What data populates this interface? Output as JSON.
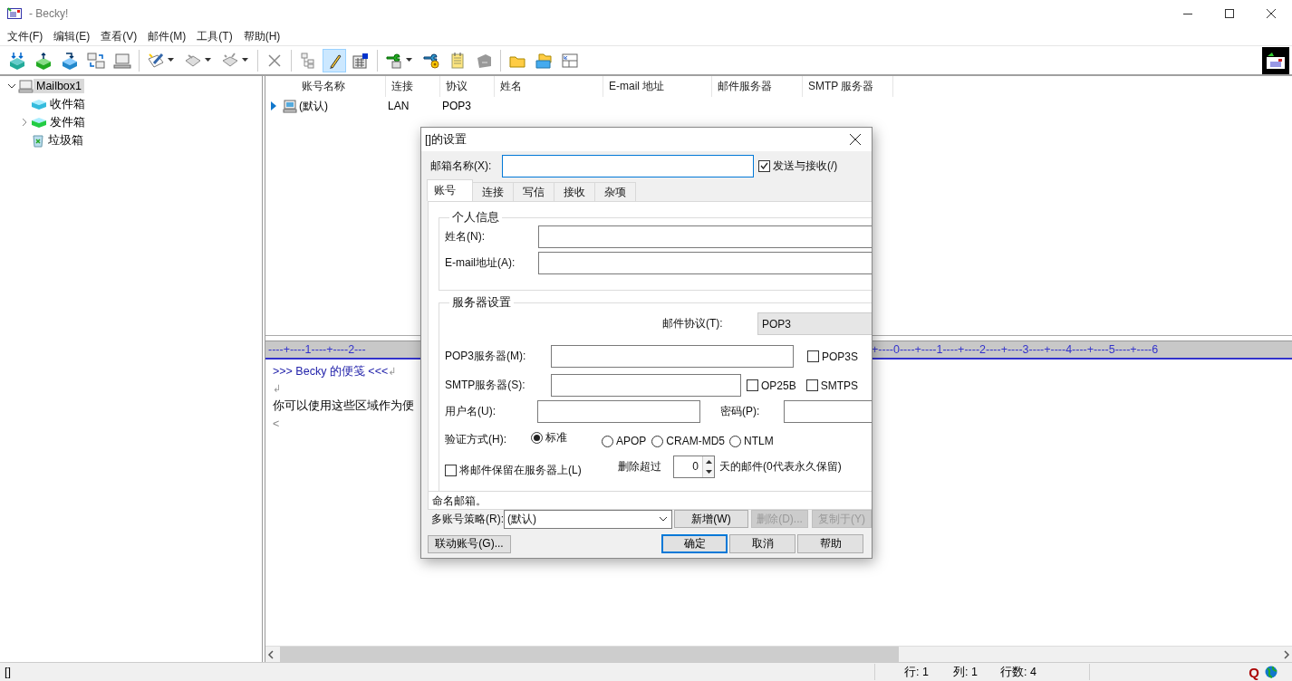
{
  "window": {
    "title": "- Becky!"
  },
  "menu": [
    "文件(F)",
    "编辑(E)",
    "查看(V)",
    "邮件(M)",
    "工具(T)",
    "帮助(H)"
  ],
  "toolbar": [
    [
      {
        "pressed": false
      },
      {
        "pressed": false
      },
      {
        "pressed": false
      },
      {
        "pressed": false
      },
      {
        "pressed": false
      }
    ],
    [
      {
        "pressed": false,
        "dropdown": true
      },
      {
        "pressed": false,
        "dropdown": true
      },
      {
        "pressed": false,
        "dropdown": true
      }
    ],
    [
      {
        "pressed": false
      }
    ],
    [
      {
        "pressed": false
      },
      {
        "pressed": true
      },
      {
        "pressed": false
      }
    ],
    [
      {
        "pressed": false,
        "dropdown": true
      },
      {
        "pressed": false
      },
      {
        "pressed": false
      },
      {
        "pressed": false
      }
    ],
    [
      {
        "pressed": false
      },
      {
        "pressed": false
      },
      {
        "pressed": false
      }
    ]
  ],
  "tree": [
    {
      "label": "Mailbox1",
      "selected": true,
      "expanded": true,
      "children": [
        {
          "label": "收件箱",
          "selected": false
        },
        {
          "label": "发件箱",
          "selected": false,
          "expanded": false
        },
        {
          "label": "垃圾箱",
          "selected": false
        }
      ]
    }
  ],
  "accounts": {
    "columns": [
      "账号名称",
      "连接",
      "协议",
      "姓名",
      "E-mail 地址",
      "邮件服务器",
      "SMTP 服务器"
    ],
    "rows": [
      {
        "current": true,
        "cells": [
          "(默认)",
          "LAN",
          "POP3"
        ]
      }
    ]
  },
  "memo": {
    "ruler_left": "----+----1----+----2---",
    "ruler_right": "+----0----+----1----+----2----+----3----+----4----+----5----+----6",
    "lines": [
      {
        "kind": "heading",
        "text": ">>> Becky 的便笺 <<<",
        "eol": "↲"
      },
      {
        "kind": "text",
        "eol": "↲"
      },
      {
        "kind": "text",
        "text": "你可以使用这些区域作为便"
      },
      {
        "kind": "mark",
        "text": "<"
      }
    ]
  },
  "status_bar": {
    "left": "[]",
    "line": "行: 1",
    "column": "列: 1",
    "count": "行数: 4",
    "q": "Q"
  },
  "dialog": {
    "title": "[]的设置",
    "mailbox_name": {
      "label": "邮箱名称(X):"
    },
    "send_receive": {
      "label": "发送与接收(/)",
      "checked": true
    },
    "tabs": [
      {
        "label": "账号",
        "selected": true
      },
      {
        "label": "连接",
        "selected": false
      },
      {
        "label": "写信",
        "selected": false
      },
      {
        "label": "接收",
        "selected": false
      },
      {
        "label": "杂项",
        "selected": false
      }
    ],
    "personal": {
      "title": "个人信息",
      "name_label": "姓名(N):",
      "email_label": "E-mail地址(A):"
    },
    "server": {
      "title": "服务器设置",
      "protocol_label": "邮件协议(T):",
      "protocol": "POP3",
      "pop3_label": "POP3服务器(M):",
      "pop3s": {
        "label": "POP3S",
        "checked": false
      },
      "smtp_label": "SMTP服务器(S):",
      "op25b": {
        "label": "OP25B",
        "checked": false
      },
      "smtps": {
        "label": "SMTPS",
        "checked": false
      },
      "user_label": "用户名(U):",
      "password_label": "密码(P):",
      "auth_label": "验证方式(H):",
      "auth": [
        {
          "label": "标准",
          "selected": true
        },
        {
          "label": "APOP",
          "selected": false
        },
        {
          "label": "CRAM-MD5",
          "selected": false
        },
        {
          "label": "NTLM",
          "selected": false
        }
      ],
      "keep": {
        "label": "将邮件保留在服务器上(L)",
        "checked": false
      },
      "delete_label": "删除超过",
      "days": "0",
      "days_suffix": "天的邮件(0代表永久保留)"
    },
    "hint": "命名邮箱。",
    "policy": {
      "label": "多账号策略(R):",
      "value": "(默认)"
    },
    "policy_buttons": [
      {
        "label": "新增(W)",
        "disabled": false
      },
      {
        "label": "删除(D)...",
        "disabled": true
      },
      {
        "label": "复制于(Y)",
        "disabled": true
      }
    ],
    "link_button": "联动账号(G)...",
    "buttons": [
      {
        "label": "确定",
        "default": true
      },
      {
        "label": "取消",
        "default": false
      },
      {
        "label": "帮助",
        "default": false
      }
    ]
  }
}
